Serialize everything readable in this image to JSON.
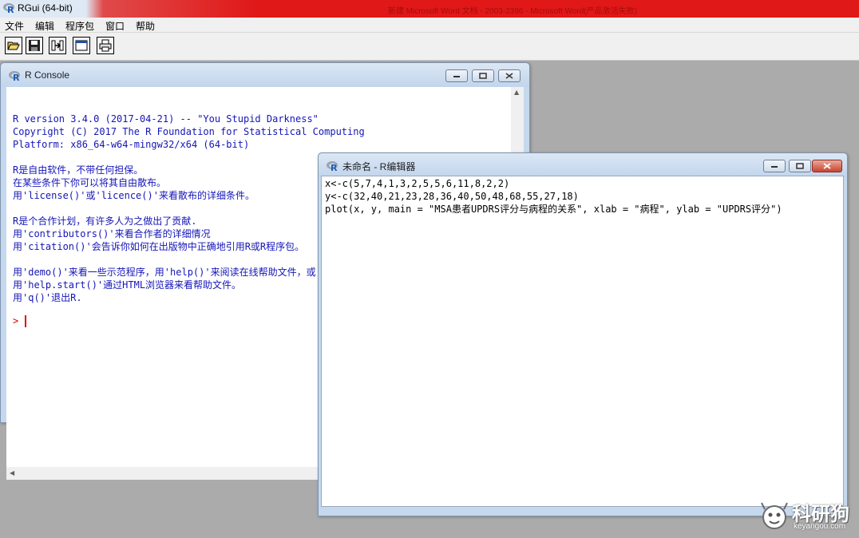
{
  "app": {
    "title": "RGui (64-bit)",
    "background_window_title": "新建 Microsoft Word 文档 - 2003-2396 - Microsoft Word(产品激活失败)"
  },
  "menu": [
    "文件",
    "编辑",
    "程序包",
    "窗口",
    "帮助"
  ],
  "toolbar": {
    "icons": [
      "open-script-icon",
      "save-icon",
      "load-workspace-icon",
      "console-icon",
      "print-icon"
    ]
  },
  "console": {
    "title": "R Console",
    "lines": [
      "R version 3.4.0 (2017-04-21) -- \"You Stupid Darkness\"",
      "Copyright (C) 2017 The R Foundation for Statistical Computing",
      "Platform: x86_64-w64-mingw32/x64 (64-bit)",
      "",
      "R是自由软件，不带任何担保。",
      "在某些条件下你可以将其自由散布。",
      "用'license()'或'licence()'来看散布的详细条件。",
      "",
      "R是个合作计划，有许多人为之做出了贡献.",
      "用'contributors()'来看合作者的详细情况",
      "用'citation()'会告诉你如何在出版物中正确地引用R或R程序包。",
      "",
      "用'demo()'来看一些示范程序，用'help()'来阅读在线帮助文件，或",
      "用'help.start()'通过HTML浏览器来看帮助文件。",
      "用'q()'退出R."
    ],
    "prompt": ">"
  },
  "editor": {
    "title": "未命名 - R编辑器",
    "lines": [
      "x<-c(5,7,4,1,3,2,5,5,6,11,8,2,2)",
      "y<-c(32,40,21,23,28,36,40,50,48,68,55,27,18)",
      "plot(x, y, main = \"MSA患者UPDRS评分与病程的关系\", xlab = \"病程\", ylab = \"UPDRS评分\")"
    ]
  },
  "watermark": {
    "text": "科研狗",
    "url": "keyangou.com"
  },
  "colors": {
    "console_text": "#1515b8",
    "prompt": "#e00000",
    "editor_text": "#000000",
    "desktop": "#ababab"
  }
}
